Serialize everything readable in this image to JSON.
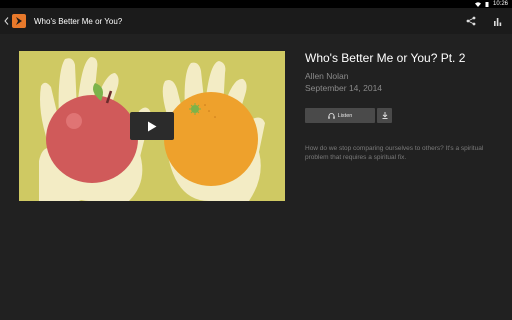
{
  "status_bar": {
    "time": "10:26"
  },
  "app_bar": {
    "title": "Who's Better Me or You?",
    "icons": [
      "back-icon",
      "app-logo-icon",
      "share-icon",
      "stats-icon"
    ]
  },
  "media": {
    "thumbnail_icons": [
      "apple-illustration",
      "orange-illustration",
      "play-icon"
    ],
    "colors": {
      "background": "#cfc963",
      "apple": "#d05a5a",
      "orange": "#eea12c",
      "hands": "#f3ecc5"
    }
  },
  "episode": {
    "title": "Who's Better Me or You? Pt. 2",
    "speaker": "Allen Nolan",
    "date": "September 14, 2014",
    "listen_label": "Listen",
    "description": "How do we stop comparing ourselves to others? It's a spiritual problem that requires a spiritual fix."
  },
  "theme": {
    "accent": "#e8792b",
    "background": "#212121",
    "appbar": "#1b1b1b"
  }
}
